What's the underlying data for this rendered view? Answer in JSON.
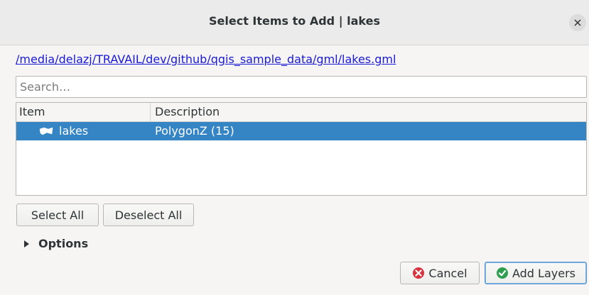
{
  "dialog": {
    "title": "Select Items to Add | lakes",
    "path": "/media/delazj/TRAVAIL/dev/github/qgis_sample_data/gml/lakes.gml"
  },
  "search": {
    "placeholder": "Search…"
  },
  "tree": {
    "columns": [
      "Item",
      "Description"
    ],
    "rows": [
      {
        "item": "lakes",
        "description": "PolygonZ (15)",
        "icon": "polygon-layer-icon",
        "selected": true
      }
    ]
  },
  "buttons": {
    "select_all": "Select All",
    "deselect_all": "Deselect All",
    "cancel": "Cancel",
    "add_layers": "Add Layers"
  },
  "options": {
    "label": "Options",
    "expanded": false
  },
  "colors": {
    "selection": "#3584c4",
    "link": "#1a1ad4",
    "cancel_icon": "#d9333f",
    "add_icon": "#2e9e4f"
  }
}
